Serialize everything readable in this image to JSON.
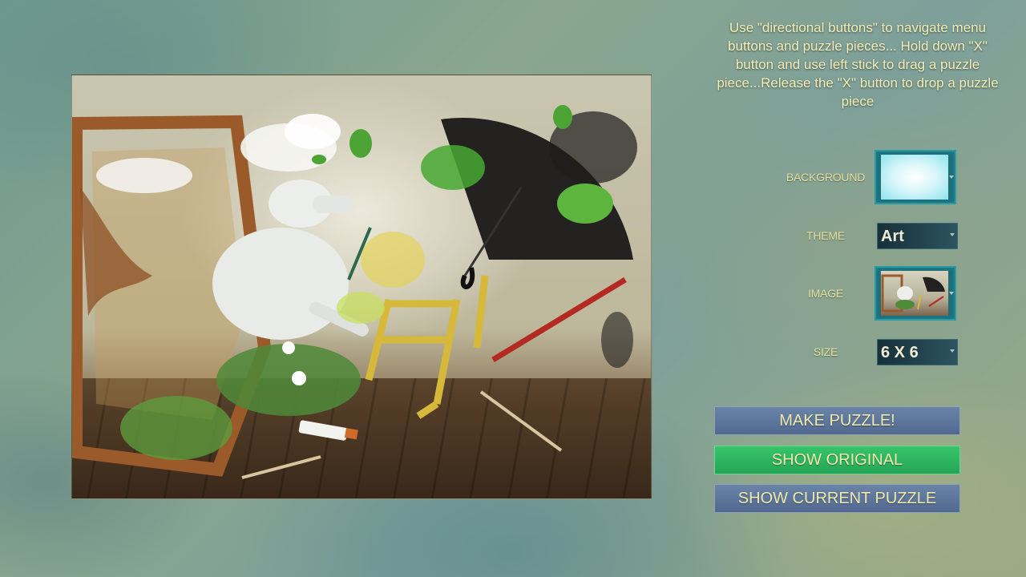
{
  "instructions": "Use \"directional buttons\" to navigate menu buttons and puzzle pieces... Hold down \"X\" button and use left stick to drag a puzzle piece...Release the \"X\" button to drop a puzzle piece",
  "options": {
    "background": {
      "label": "BACKGROUND"
    },
    "theme": {
      "label": "THEME",
      "value": "Art"
    },
    "image": {
      "label": "IMAGE"
    },
    "size": {
      "label": "SIZE",
      "value": "6 X 6"
    }
  },
  "buttons": {
    "make_puzzle": "MAKE PUZZLE!",
    "show_original": "SHOW ORIGINAL",
    "show_current": "SHOW CURRENT PUZZLE"
  },
  "colors": {
    "button_blue": "#5f779d",
    "button_green": "#2db660",
    "label_text": "#e6df9e",
    "instruction_text": "#f4f0b8"
  },
  "icons": {
    "dropdown": "chevron-down-icon"
  }
}
